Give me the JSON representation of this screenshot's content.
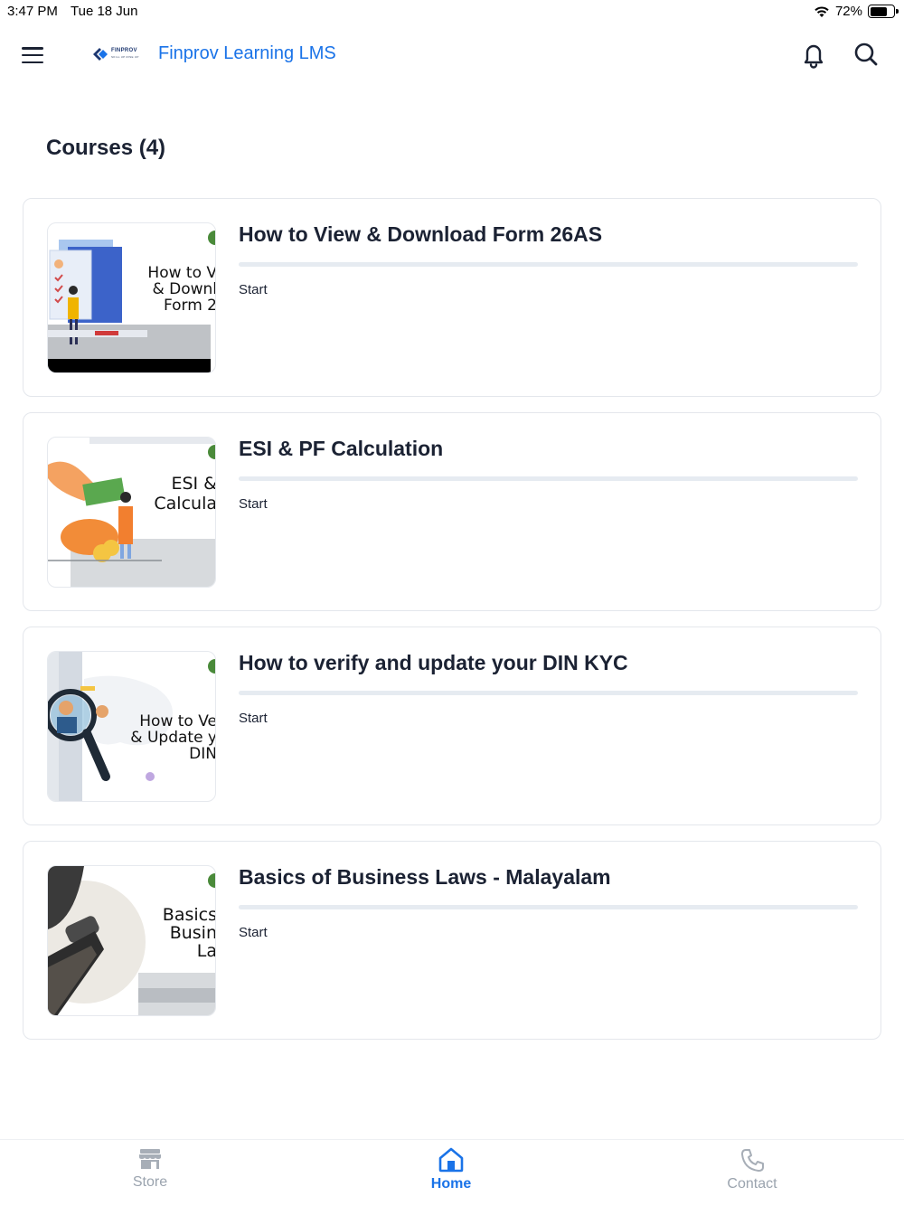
{
  "status_bar": {
    "time": "3:47 PM",
    "date": "Tue 18 Jun",
    "battery": "72%",
    "battery_level": 0.72
  },
  "app": {
    "title": "Finprov Learning LMS",
    "logo_text": "FINPROV",
    "logo_tagline": "SKILL UP RISE UP",
    "brand_color": "#1a73e8"
  },
  "courses_section": {
    "title": "Courses (4)"
  },
  "courses": [
    {
      "title": "How to View & Download Form 26AS",
      "status": "Start",
      "thumb_text": "How to V\n& Downl\nForm 2",
      "progress": 0
    },
    {
      "title": "ESI & PF Calculation",
      "status": "Start",
      "thumb_text": "ESI &\nCalcula",
      "progress": 0
    },
    {
      "title": "How to verify and update your DIN KYC",
      "status": "Start",
      "thumb_text": "How to Ve\n& Update y\nDIN",
      "progress": 0
    },
    {
      "title": "Basics of Business Laws - Malayalam",
      "status": "Start",
      "thumb_text": "Basics\nBusin\nLa",
      "progress": 0
    }
  ],
  "bottom_nav": {
    "store": "Store",
    "home": "Home",
    "contact": "Contact",
    "active": "Home"
  },
  "icons": [
    "menu-icon",
    "bell-icon",
    "search-icon",
    "store-icon",
    "home-icon",
    "phone-icon",
    "wifi-icon",
    "battery-icon"
  ]
}
